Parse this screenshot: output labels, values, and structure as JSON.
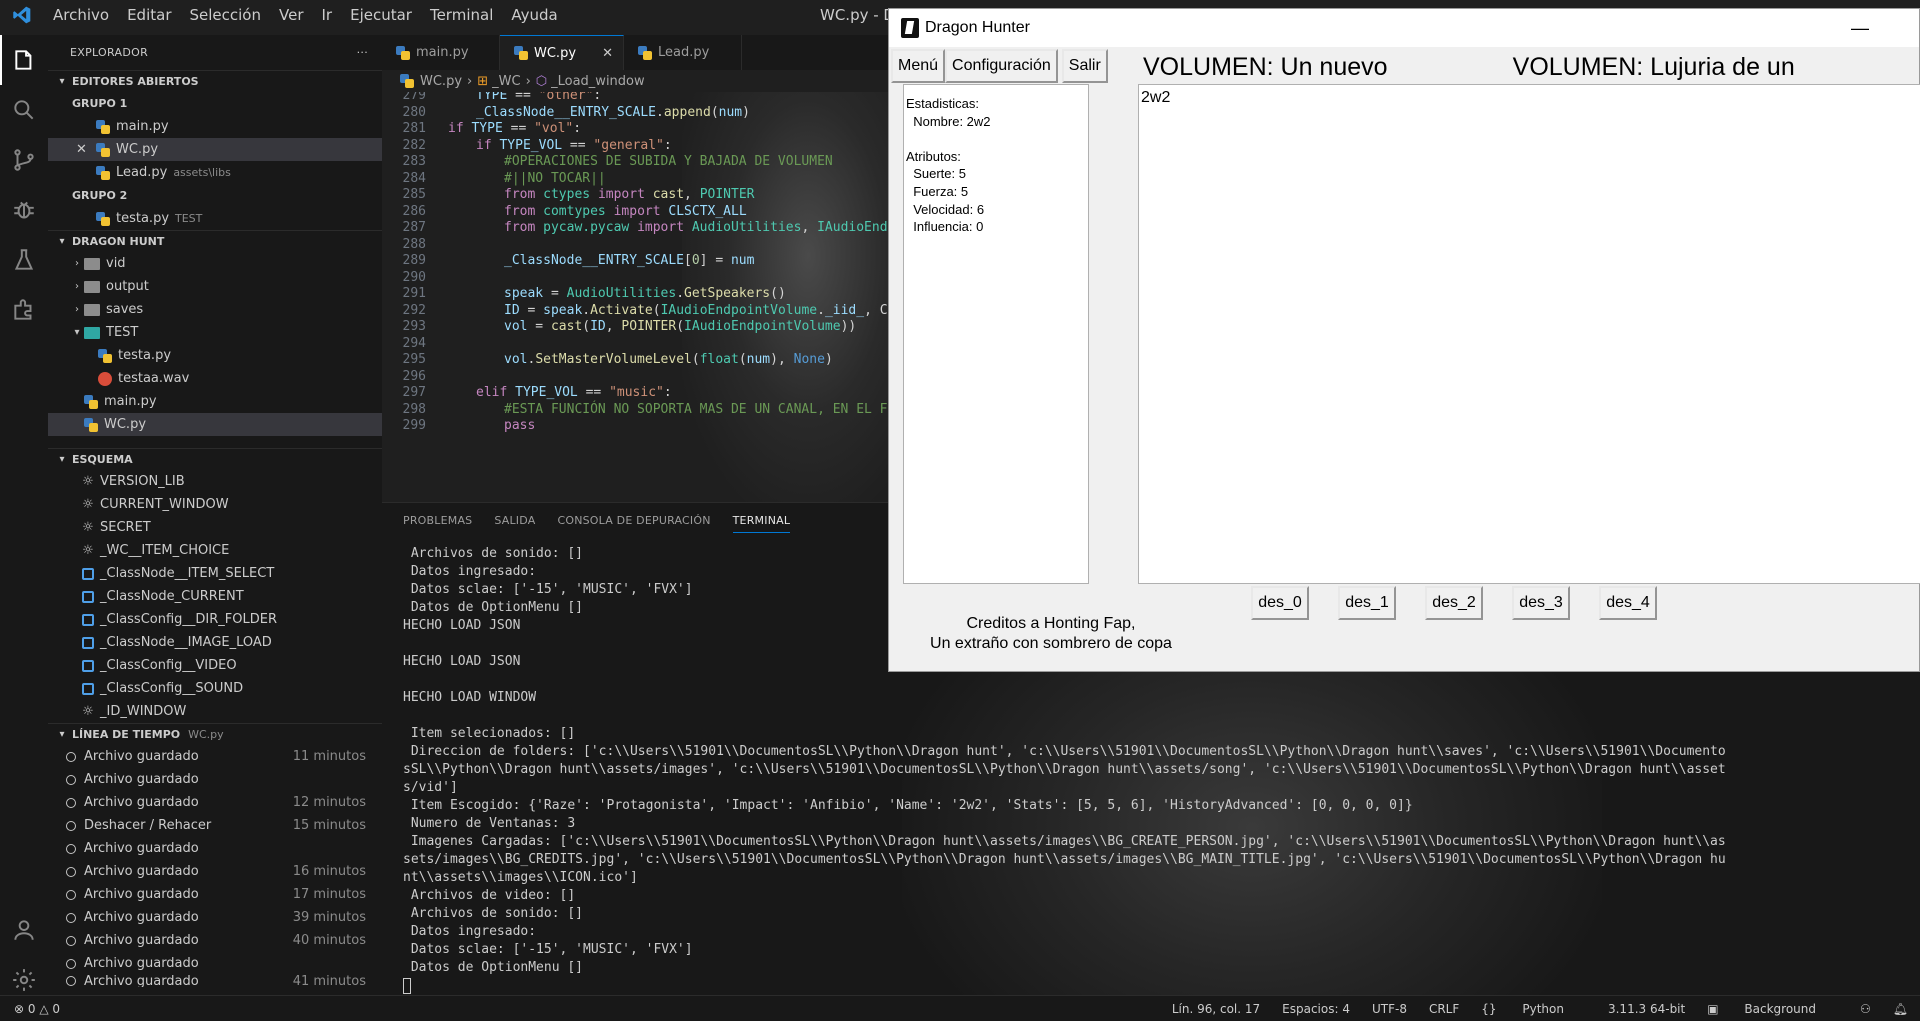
{
  "titlebar": {
    "menu": [
      "Archivo",
      "Editar",
      "Selección",
      "Ver",
      "Ir",
      "Ejecutar",
      "Terminal",
      "Ayuda"
    ],
    "title": "WC.py - D"
  },
  "sidebar": {
    "explorer_label": "EXPLORADOR",
    "more": "···",
    "open_editors": {
      "title": "EDITORES ABIERTOS",
      "group1": "GRUPO 1",
      "group1_items": [
        {
          "name": "main.py",
          "extra": ""
        },
        {
          "name": "WC.py",
          "extra": ""
        },
        {
          "name": "Lead.py",
          "extra": "assets\\libs"
        }
      ],
      "group2": "GRUPO 2",
      "group2_items": [
        {
          "name": "testa.py",
          "extra": "TEST"
        }
      ],
      "close_glyph": "✕"
    },
    "project": {
      "title": "DRAGON HUNT",
      "items": [
        "vid",
        "output",
        "saves",
        "TEST",
        "testa.py",
        "testaa.wav",
        "main.py",
        "WC.py"
      ]
    },
    "outline": {
      "title": "ESQUEMA",
      "items": [
        "VERSION_LIB",
        "CURRENT_WINDOW",
        "SECRET",
        "_WC__ITEM_CHOICE",
        "_ClassNode__ITEM_SELECT",
        "_ClassNode_CURRENT",
        "_ClassConfig__DIR_FOLDER",
        "_ClassNode__IMAGE_LOAD",
        "_ClassConfig__VIDEO",
        "_ClassConfig__SOUND",
        "_ID_WINDOW"
      ]
    },
    "timeline": {
      "title": "LÍNEA DE TIEMPO",
      "file": "WC.py",
      "items": [
        {
          "label": "Archivo guardado",
          "time": "11 minutos"
        },
        {
          "label": "Archivo guardado",
          "time": ""
        },
        {
          "label": "Archivo guardado",
          "time": "12 minutos"
        },
        {
          "label": "Deshacer / Rehacer",
          "time": "15 minutos"
        },
        {
          "label": "Archivo guardado",
          "time": ""
        },
        {
          "label": "Archivo guardado",
          "time": "16 minutos"
        },
        {
          "label": "Archivo guardado",
          "time": "17 minutos"
        },
        {
          "label": "Archivo guardado",
          "time": "39 minutos"
        },
        {
          "label": "Archivo guardado",
          "time": "40 minutos"
        },
        {
          "label": "Archivo guardado",
          "time": ""
        },
        {
          "label": "Archivo guardado",
          "time": "41 minutos"
        }
      ]
    }
  },
  "editor": {
    "tabs": [
      "main.py",
      "WC.py",
      "Lead.py"
    ],
    "tab_close": "✕",
    "breadcrumb": [
      "WC.py",
      "_WC",
      "_Load_window"
    ],
    "lines": [
      {
        "n": "279",
        "indent": 1,
        "parts": [
          [
            "var",
            "TYPE"
          ],
          [
            "plain",
            " == "
          ],
          [
            "str",
            "\"other\""
          ],
          [
            "plain",
            ":"
          ]
        ]
      },
      {
        "n": "280",
        "indent": 1,
        "parts": [
          [
            "var",
            "_ClassNode__ENTRY_SCALE"
          ],
          [
            "plain",
            "."
          ],
          [
            "fn",
            "append"
          ],
          [
            "plain",
            "("
          ],
          [
            "var",
            "num"
          ],
          [
            "plain",
            ")"
          ]
        ]
      },
      {
        "n": "281",
        "indent": 0,
        "parts": [
          [
            "kw",
            "if"
          ],
          [
            "plain",
            " "
          ],
          [
            "var",
            "TYPE"
          ],
          [
            "plain",
            " == "
          ],
          [
            "str",
            "\"vol\""
          ],
          [
            "plain",
            ":"
          ]
        ]
      },
      {
        "n": "282",
        "indent": 1,
        "parts": [
          [
            "kw",
            "if"
          ],
          [
            "plain",
            " "
          ],
          [
            "var",
            "TYPE_VOL"
          ],
          [
            "plain",
            " == "
          ],
          [
            "str",
            "\"general\""
          ],
          [
            "plain",
            ":"
          ]
        ]
      },
      {
        "n": "283",
        "indent": 2,
        "parts": [
          [
            "cm",
            "#OPERACIONES DE SUBIDA Y BAJADA DE VOLUMEN"
          ]
        ]
      },
      {
        "n": "284",
        "indent": 2,
        "parts": [
          [
            "cm",
            "#||NO TOCAR||"
          ]
        ]
      },
      {
        "n": "285",
        "indent": 2,
        "parts": [
          [
            "kw",
            "from"
          ],
          [
            "plain",
            " "
          ],
          [
            "cls",
            "ctypes"
          ],
          [
            "plain",
            " "
          ],
          [
            "kw",
            "import"
          ],
          [
            "plain",
            " "
          ],
          [
            "fn",
            "cast"
          ],
          [
            "plain",
            ", "
          ],
          [
            "cls",
            "POINTER"
          ]
        ]
      },
      {
        "n": "286",
        "indent": 2,
        "parts": [
          [
            "kw",
            "from"
          ],
          [
            "plain",
            " "
          ],
          [
            "cls",
            "comtypes"
          ],
          [
            "plain",
            " "
          ],
          [
            "kw",
            "import"
          ],
          [
            "plain",
            " "
          ],
          [
            "var",
            "CLSCTX_ALL"
          ]
        ]
      },
      {
        "n": "287",
        "indent": 2,
        "parts": [
          [
            "kw",
            "from"
          ],
          [
            "plain",
            " "
          ],
          [
            "cls",
            "pycaw.pycaw"
          ],
          [
            "plain",
            " "
          ],
          [
            "kw",
            "import"
          ],
          [
            "plain",
            " "
          ],
          [
            "cls",
            "AudioUtilities"
          ],
          [
            "plain",
            ", "
          ],
          [
            "cls",
            "IAudioEnd"
          ]
        ]
      },
      {
        "n": "288",
        "indent": 0,
        "parts": []
      },
      {
        "n": "289",
        "indent": 2,
        "parts": [
          [
            "var",
            "_ClassNode__ENTRY_SCALE"
          ],
          [
            "plain",
            "["
          ],
          [
            "num",
            "0"
          ],
          [
            "plain",
            "] = "
          ],
          [
            "var",
            "num"
          ]
        ]
      },
      {
        "n": "290",
        "indent": 0,
        "parts": []
      },
      {
        "n": "291",
        "indent": 2,
        "parts": [
          [
            "var",
            "speak"
          ],
          [
            "plain",
            " = "
          ],
          [
            "cls",
            "AudioUtilities"
          ],
          [
            "plain",
            "."
          ],
          [
            "fn",
            "GetSpeakers"
          ],
          [
            "plain",
            "()"
          ]
        ]
      },
      {
        "n": "292",
        "indent": 2,
        "parts": [
          [
            "var",
            "ID"
          ],
          [
            "plain",
            " = "
          ],
          [
            "var",
            "speak"
          ],
          [
            "plain",
            "."
          ],
          [
            "fn",
            "Activate"
          ],
          [
            "plain",
            "("
          ],
          [
            "cls",
            "IAudioEndpointVolume"
          ],
          [
            "plain",
            "."
          ],
          [
            "var",
            "_iid_"
          ],
          [
            "plain",
            ", C"
          ]
        ]
      },
      {
        "n": "293",
        "indent": 2,
        "parts": [
          [
            "var",
            "vol"
          ],
          [
            "plain",
            " = "
          ],
          [
            "fn",
            "cast"
          ],
          [
            "plain",
            "("
          ],
          [
            "var",
            "ID"
          ],
          [
            "plain",
            ", "
          ],
          [
            "fn",
            "POINTER"
          ],
          [
            "plain",
            "("
          ],
          [
            "cls",
            "IAudioEndpointVolume"
          ],
          [
            "plain",
            "))"
          ]
        ]
      },
      {
        "n": "294",
        "indent": 0,
        "parts": []
      },
      {
        "n": "295",
        "indent": 2,
        "parts": [
          [
            "var",
            "vol"
          ],
          [
            "plain",
            "."
          ],
          [
            "fn",
            "SetMasterVolumeLevel"
          ],
          [
            "plain",
            "("
          ],
          [
            "cls",
            "float"
          ],
          [
            "plain",
            "("
          ],
          [
            "var",
            "num"
          ],
          [
            "plain",
            "), "
          ],
          [
            "kw2",
            "None"
          ],
          [
            "plain",
            ")"
          ]
        ]
      },
      {
        "n": "296",
        "indent": 0,
        "parts": []
      },
      {
        "n": "297",
        "indent": 1,
        "parts": [
          [
            "kw",
            "elif"
          ],
          [
            "plain",
            " "
          ],
          [
            "var",
            "TYPE_VOL"
          ],
          [
            "plain",
            " == "
          ],
          [
            "str",
            "\"music\""
          ],
          [
            "plain",
            ":"
          ]
        ]
      },
      {
        "n": "298",
        "indent": 2,
        "parts": [
          [
            "cm",
            "#ESTA FUNCIÓN NO SOPORTA MAS DE UN CANAL, EN EL F"
          ]
        ]
      },
      {
        "n": "299",
        "indent": 2,
        "parts": [
          [
            "kw",
            "pass"
          ]
        ]
      }
    ]
  },
  "panel": {
    "tabs": [
      "PROBLEMAS",
      "SALIDA",
      "CONSOLA DE DEPURACIÓN",
      "TERMINAL"
    ],
    "terminal_lines": [
      " Archivos de sonido: []",
      " Datos ingresado:",
      " Datos sclae: ['-15', 'MUSIC', 'FVX']",
      " Datos de OptionMenu []",
      "HECHO LOAD JSON",
      "",
      "HECHO LOAD JSON",
      "",
      "HECHO LOAD WINDOW",
      "",
      " Item selecionados: []",
      " Direccion de folders: ['c:\\\\Users\\\\51901\\\\DocumentosSL\\\\Python\\\\Dragon hunt', 'c:\\\\Users\\\\51901\\\\DocumentosSL\\\\Python\\\\Dragon hunt\\\\saves', 'c:\\\\Users\\\\51901\\\\Documento",
      "sSL\\\\Python\\\\Dragon hunt\\\\assets/images', 'c:\\\\Users\\\\51901\\\\DocumentosSL\\\\Python\\\\Dragon hunt\\\\assets/song', 'c:\\\\Users\\\\51901\\\\DocumentosSL\\\\Python\\\\Dragon hunt\\\\asset",
      "s/vid']",
      " Item Escogido: {'Raze': 'Protagonista', 'Impact': 'Anfibio', 'Name': '2w2', 'Stats': [5, 5, 6], 'HistoryAdvanced': [0, 0, 0, 0]}",
      " Numero de Ventanas: 3",
      " Imagenes Cargadas: ['c:\\\\Users\\\\51901\\\\DocumentosSL\\\\Python\\\\Dragon hunt\\\\assets/images\\\\BG_CREATE_PERSON.jpg', 'c:\\\\Users\\\\51901\\\\DocumentosSL\\\\Python\\\\Dragon hunt\\\\as",
      "sets/images\\\\BG_CREDITS.jpg', 'c:\\\\Users\\\\51901\\\\DocumentosSL\\\\Python\\\\Dragon hunt\\\\assets/images\\\\BG_MAIN_TITLE.jpg', 'c:\\\\Users\\\\51901\\\\DocumentosSL\\\\Python\\\\Dragon hu",
      "nt\\\\assets\\\\images\\\\ICON.ico']",
      " Archivos de video: []",
      " Archivos de sonido: []",
      " Datos ingresado:",
      " Datos sclae: ['-15', 'MUSIC', 'FVX']",
      " Datos de OptionMenu []"
    ]
  },
  "statusbar": {
    "problems": "⊗ 0 △ 0",
    "position": "Lín. 96, col. 17",
    "spaces": "Espacios: 4",
    "encoding": "UTF-8",
    "eol": "CRLF",
    "language": "Python",
    "interpreter": "3.11.3 64-bit",
    "background": "Background"
  },
  "tkwindow": {
    "title": "Dragon Hunter",
    "minimize": "—",
    "menu": [
      "Menú",
      "Configuración",
      "Salir"
    ],
    "stats_lines": [
      "Estadisticas:",
      "  Nombre: 2w2",
      "",
      "Atributos:",
      "  Suerte: 5",
      "  Fuerza: 5",
      "  Velocidad: 6",
      "  Influencia: 0"
    ],
    "vol1": "VOLUMEN: Un nuevo mundo.",
    "vol2": "VOLUMEN: Lujuria de un dragon.",
    "text_content": "2w2",
    "des_buttons": [
      "des_0",
      "des_1",
      "des_2",
      "des_3",
      "des_4"
    ],
    "credits1": "Creditos a Honting Fap,",
    "credits2": "Un extraño con sombrero de copa"
  },
  "colors": {
    "accent": "#0078d4",
    "python_blue": "#3b7bbf",
    "python_yellow": "#f1c232"
  }
}
